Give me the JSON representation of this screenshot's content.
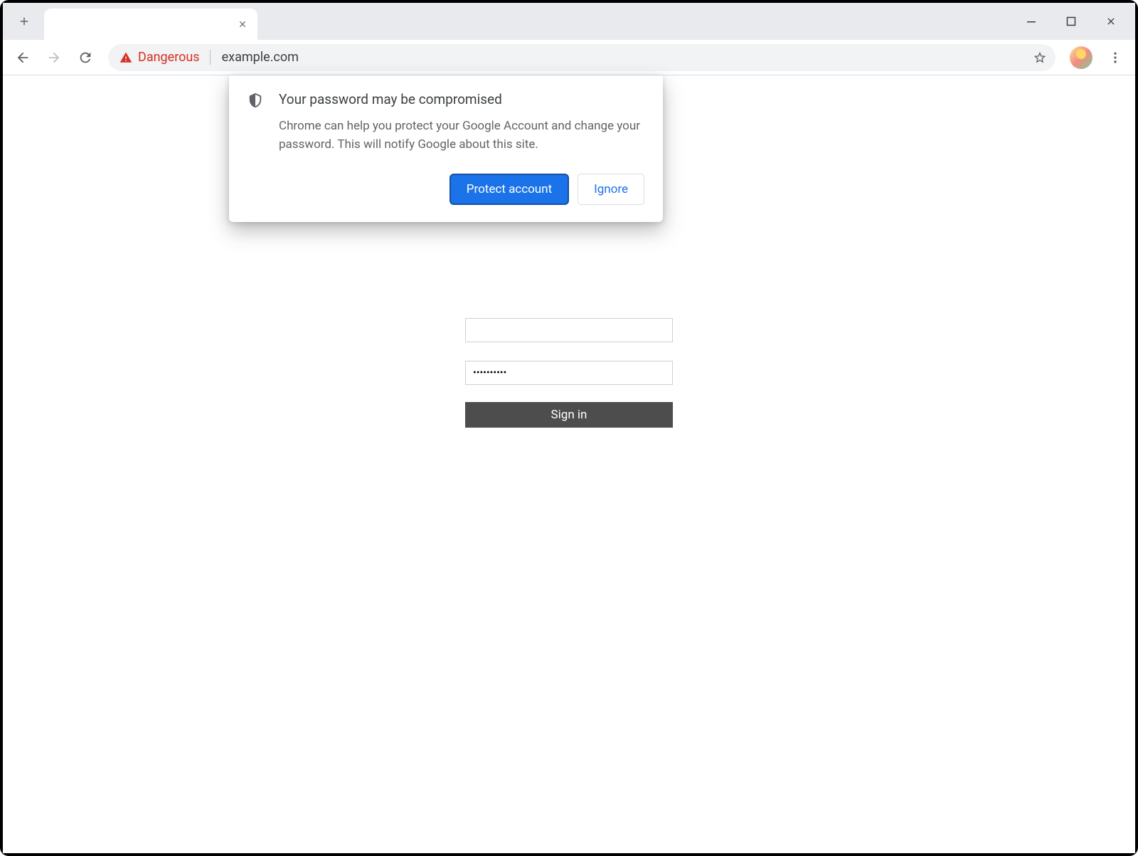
{
  "addressBar": {
    "securityLabel": "Dangerous",
    "url": "example.com"
  },
  "bubble": {
    "title": "Your password may be compromised",
    "description": "Chrome can help you protect your Google Account and change your password. This will notify Google about this site.",
    "primaryButton": "Protect account",
    "secondaryButton": "Ignore"
  },
  "loginForm": {
    "usernameValue": "",
    "passwordValue": "••••••••••",
    "submitLabel": "Sign in"
  }
}
